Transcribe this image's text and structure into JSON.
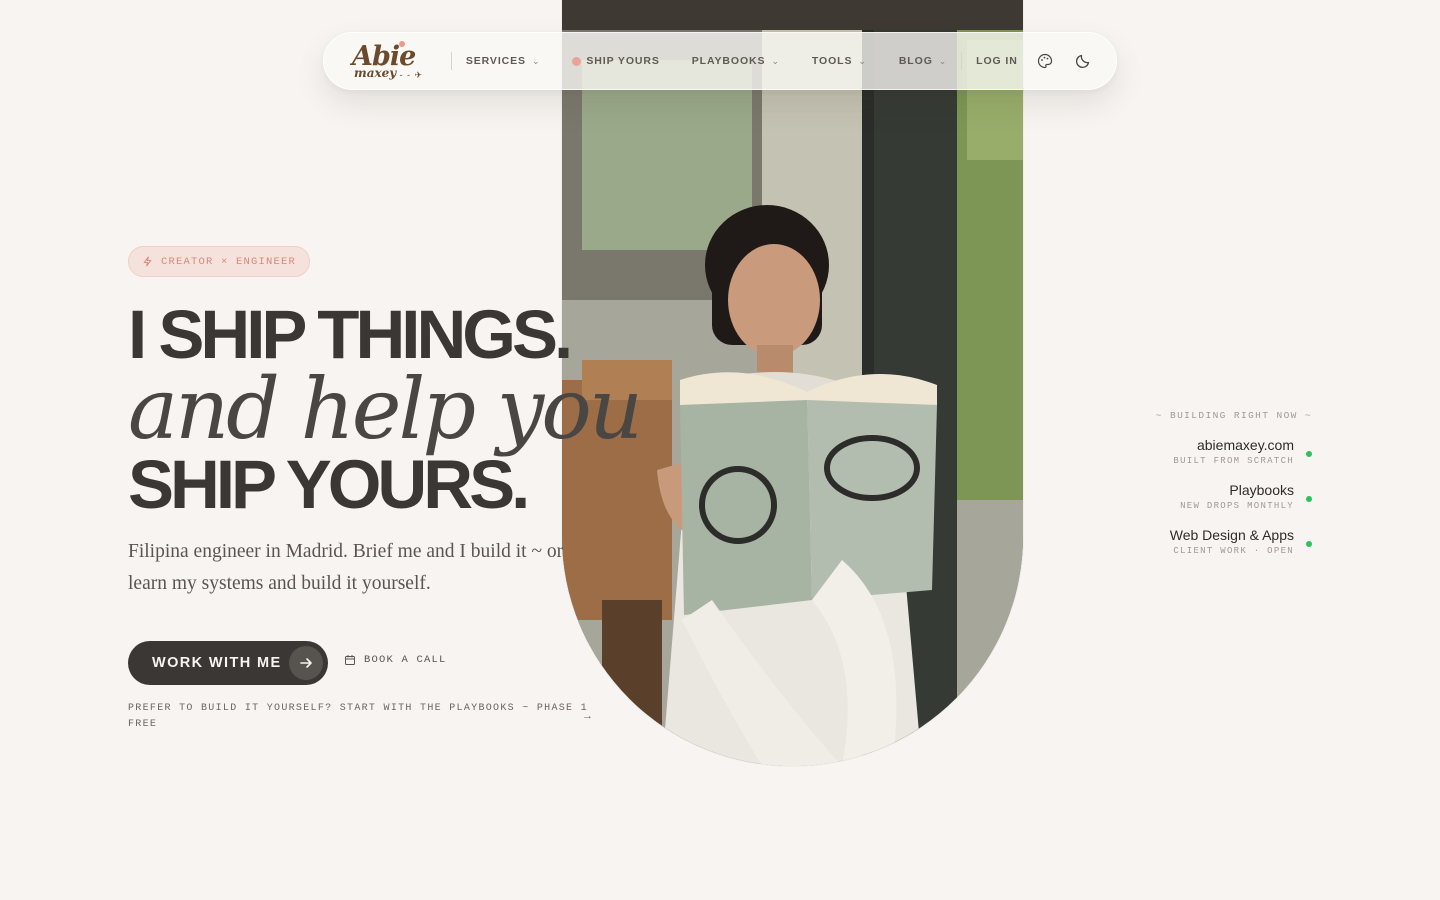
{
  "nav": {
    "logo_main": "Abie",
    "logo_sub": "maxey",
    "items": [
      {
        "label": "SERVICES",
        "has_caret": true
      },
      {
        "label": "SHIP YOURS",
        "has_dot": true
      },
      {
        "label": "PLAYBOOKS",
        "has_caret": true
      },
      {
        "label": "TOOLS",
        "has_caret": true
      },
      {
        "label": "BLOG",
        "has_caret": true
      }
    ],
    "login": "LOG IN",
    "icons": [
      "palette-icon",
      "moon-icon"
    ]
  },
  "hero": {
    "badge": "CREATOR × ENGINEER",
    "line1": "I SHIP THINGS.",
    "line2": "and help you",
    "line3": "SHIP YOURS.",
    "subtitle": "Filipina engineer in Madrid. Brief me and I build it ~ or learn my systems and build it yourself.",
    "cta_primary": "WORK WITH ME",
    "cta_secondary": "BOOK A CALL",
    "playbook_link": "PREFER TO BUILD IT YOURSELF? START WITH THE PLAYBOOKS ~ PHASE 1 FREE"
  },
  "building": {
    "title": "~ BUILDING RIGHT NOW ~",
    "projects": [
      {
        "name": "abiemaxey.com",
        "note": "BUILT FROM SCRATCH"
      },
      {
        "name": "Playbooks",
        "note": "NEW DROPS MONTHLY"
      },
      {
        "name": "Web Design & Apps",
        "note": "CLIENT WORK · OPEN"
      }
    ]
  },
  "colors": {
    "background": "#f7f4f1",
    "text_dark": "#3a3735",
    "accent_pink": "#e8a39a",
    "status_green": "#2fc15b",
    "logo_brown": "#6b4a2e"
  }
}
